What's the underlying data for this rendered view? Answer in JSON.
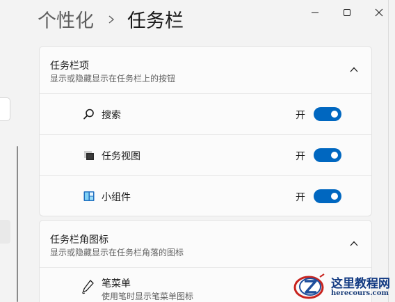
{
  "window": {
    "breadcrumb_parent": "个性化",
    "breadcrumb_separator": "›",
    "breadcrumb_current": "任务栏"
  },
  "taskbar_items_section": {
    "title": "任务栏项",
    "subtitle": "显示或隐藏显示在任务栏上的按钮",
    "expanded": true,
    "items": [
      {
        "label": "搜索",
        "icon": "search-icon",
        "state_label": "开",
        "on": true
      },
      {
        "label": "任务视图",
        "icon": "task-view-icon",
        "state_label": "开",
        "on": true
      },
      {
        "label": "小组件",
        "icon": "widgets-icon",
        "state_label": "开",
        "on": true
      }
    ]
  },
  "corner_icons_section": {
    "title": "任务栏角图标",
    "subtitle": "显示或隐藏显示在任务栏角落的图标",
    "expanded": true,
    "items": [
      {
        "label": "笔菜单",
        "subtitle": "使用笔时显示笔菜单图标",
        "icon": "pen-icon"
      }
    ]
  },
  "watermark": {
    "title": "这里教程网",
    "domain": "herecours.com"
  },
  "colors": {
    "accent": "#0067c0",
    "background": "#f3f3f3",
    "card": "#fbfbfb"
  }
}
